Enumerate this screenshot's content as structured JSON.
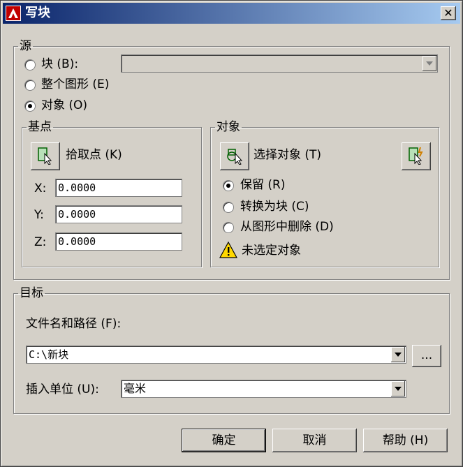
{
  "window": {
    "title": "写块",
    "close_glyph": "✕"
  },
  "source": {
    "legend": "源",
    "options": [
      {
        "label": "块 (B):",
        "selected": false
      },
      {
        "label": "整个图形 (E)",
        "selected": false
      },
      {
        "label": "对象 (O)",
        "selected": true
      }
    ],
    "block_combo_value": ""
  },
  "base_point": {
    "legend": "基点",
    "pick_label": "拾取点 (K)",
    "x_label": "X:",
    "x_value": "0.0000",
    "y_label": "Y:",
    "y_value": "0.0000",
    "z_label": "Z:",
    "z_value": "0.0000"
  },
  "objects": {
    "legend": "对象",
    "select_label": "选择对象 (T)",
    "options": [
      {
        "label": "保留 (R)",
        "selected": true
      },
      {
        "label": "转换为块 (C)",
        "selected": false
      },
      {
        "label": "从图形中删除 (D)",
        "selected": false
      }
    ],
    "warning": "未选定对象"
  },
  "destination": {
    "legend": "目标",
    "file_label": "文件名和路径 (F):",
    "file_value": "C:\\新块",
    "browse_label": "...",
    "units_label": "插入单位 (U):",
    "units_value": "毫米"
  },
  "buttons": {
    "ok": "确定",
    "cancel": "取消",
    "help": "帮助 (H)"
  },
  "icons": [
    "autocad-app-icon",
    "close-icon",
    "pick-point-icon",
    "select-objects-icon",
    "quick-select-icon",
    "warning-icon",
    "dropdown-arrow-icon"
  ]
}
